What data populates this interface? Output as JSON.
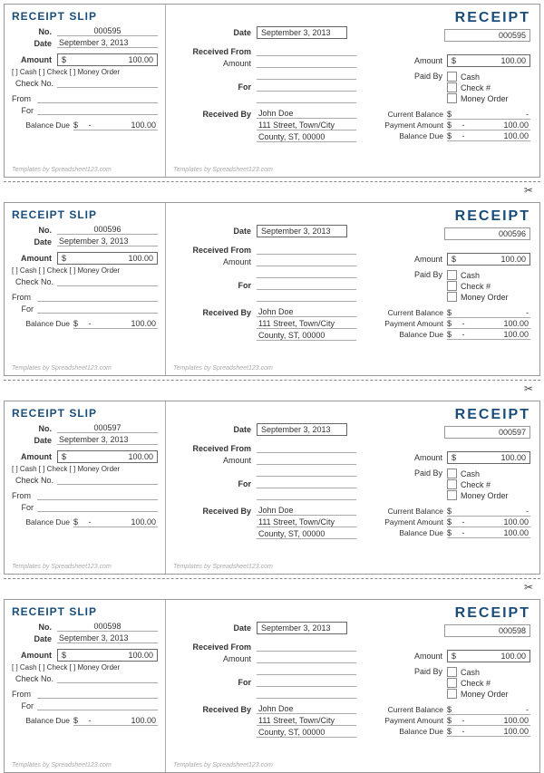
{
  "slip_title": "RECEIPT SLIP",
  "receipt_title": "RECEIPT",
  "labels": {
    "no": "No.",
    "date": "Date",
    "amount": "Amount",
    "payment_types": "[ ] Cash   [ ] Check   [ ] Money Order",
    "check_no": "Check No.",
    "from": "From",
    "for": "For",
    "balance_due": "Balance Due",
    "received_from": "Received From",
    "received_by": "Received By",
    "paid_by": "Paid By",
    "cash": "Cash",
    "check_num": "Check #",
    "money_order": "Money Order",
    "current_balance": "Current Balance",
    "payment_amount": "Payment Amount",
    "templates": "Templates by Spreadsheet123.com"
  },
  "currency": "$",
  "dash": "-",
  "receipts": [
    {
      "no": "000595",
      "date": "September 3, 2013",
      "amount": "100.00",
      "received_by": "John Doe",
      "addr1": "111 Street, Town/City",
      "addr2": "County, ST, 00000",
      "current_balance": "-",
      "payment_amount": "100.00",
      "balance_due": "100.00"
    },
    {
      "no": "000596",
      "date": "September 3, 2013",
      "amount": "100.00",
      "received_by": "John Doe",
      "addr1": "111 Street, Town/City",
      "addr2": "County, ST, 00000",
      "current_balance": "-",
      "payment_amount": "100.00",
      "balance_due": "100.00"
    },
    {
      "no": "000597",
      "date": "September 3, 2013",
      "amount": "100.00",
      "received_by": "John Doe",
      "addr1": "111 Street, Town/City",
      "addr2": "County, ST, 00000",
      "current_balance": "-",
      "payment_amount": "100.00",
      "balance_due": "100.00"
    },
    {
      "no": "000598",
      "date": "September 3, 2013",
      "amount": "100.00",
      "received_by": "John Doe",
      "addr1": "111 Street, Town/City",
      "addr2": "County, ST, 00000",
      "current_balance": "-",
      "payment_amount": "100.00",
      "balance_due": "100.00"
    }
  ]
}
